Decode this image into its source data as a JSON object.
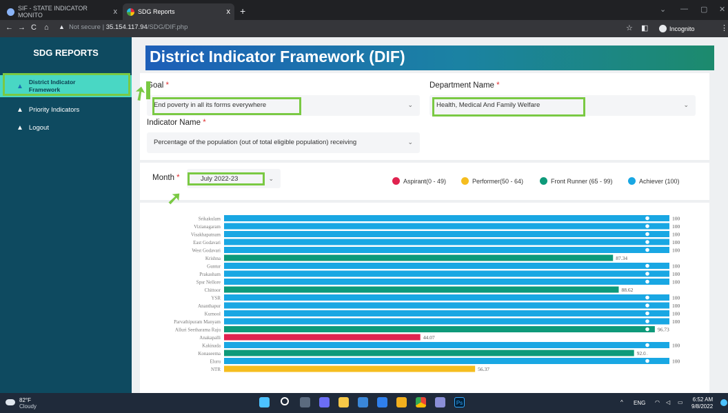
{
  "browser": {
    "tabs": [
      {
        "title": "SIF - STATE INDICATOR MONITO",
        "close": "x"
      },
      {
        "title": "SDG Reports",
        "close": "x"
      }
    ],
    "new_tab": "+",
    "not_secure": "Not secure",
    "url_host": "35.154.117.94",
    "url_path": "/SDG/DIF.php",
    "incognito_label": "Incognito",
    "colors": {
      "frame": "#202124",
      "toolbar": "#35363a"
    }
  },
  "sidebar": {
    "title": "SDG REPORTS",
    "items": [
      {
        "label_line1": "District Indicator",
        "label_line2": "Framework",
        "icon": "user-icon",
        "active": true
      },
      {
        "label": "Priority Indicators",
        "icon": "user-icon"
      },
      {
        "label": "Logout",
        "icon": "user-icon"
      }
    ],
    "colors": {
      "bg": "#0e4a60",
      "active": "#49d7c4"
    }
  },
  "page": {
    "title": "District Indicator Framework (DIF)",
    "goal": {
      "label": "Goal",
      "required": "*",
      "value": "End poverty in all its forms everywhere"
    },
    "department": {
      "label": "Department Name",
      "required": "*",
      "value": "Health, Medical And Family Welfare"
    },
    "indicator": {
      "label": "Indicator Name",
      "required": "*",
      "value": "Percentage of the population (out of total eligible population) receiving"
    },
    "month": {
      "label": "Month",
      "required": "*",
      "value": "July 2022-23"
    },
    "legend": [
      {
        "label": "Aspirant(0 - 49)",
        "color": "#e0234f"
      },
      {
        "label": "Performer(50 - 64)",
        "color": "#f5bd1f"
      },
      {
        "label": "Front Runner (65 - 99)",
        "color": "#0e9a7a"
      },
      {
        "label": "Achiever (100)",
        "color": "#19a7e3"
      }
    ]
  },
  "chart_data": {
    "type": "bar",
    "orientation": "horizontal",
    "categories": [
      "Srikakulam",
      "Vizianagaram",
      "Visakhapatnam",
      "East Godavari",
      "West Godavari",
      "Krishna",
      "Guntur",
      "Prakasham",
      "Spsr Nellore",
      "Chittoor",
      "YSR",
      "Ananthapur",
      "Kurnool",
      "Parvathipuram Manyam",
      "Alluri Seetharama Raju",
      "Anakapalli",
      "Kakinada",
      "Konaseema",
      "Eluru",
      "NTR"
    ],
    "values": [
      100,
      100,
      100,
      100,
      100,
      87.34,
      100,
      100,
      100,
      88.62,
      100,
      100,
      100,
      100,
      96.73,
      44.07,
      100,
      92.06,
      100,
      56.37
    ],
    "data_labels": [
      "100",
      "100",
      "100",
      "100",
      "100",
      "87.34",
      "100",
      "100",
      "100",
      "88.62",
      "100",
      "100",
      "100",
      "100",
      "96.73",
      "44.07",
      "100",
      "92.06",
      "100",
      "56.37"
    ],
    "xlim": [
      0,
      100
    ],
    "colors": {
      "aspirant": "#e0234f",
      "performer": "#f5bd1f",
      "front_runner": "#0e9a7a",
      "achiever": "#19a7e3"
    }
  },
  "taskbar": {
    "weather_temp": "82°F",
    "weather_desc": "Cloudy",
    "lang": "ENG",
    "time": "6:52 AM",
    "date": "9/8/2022",
    "ps_label": "Ps",
    "chevron": "^"
  }
}
